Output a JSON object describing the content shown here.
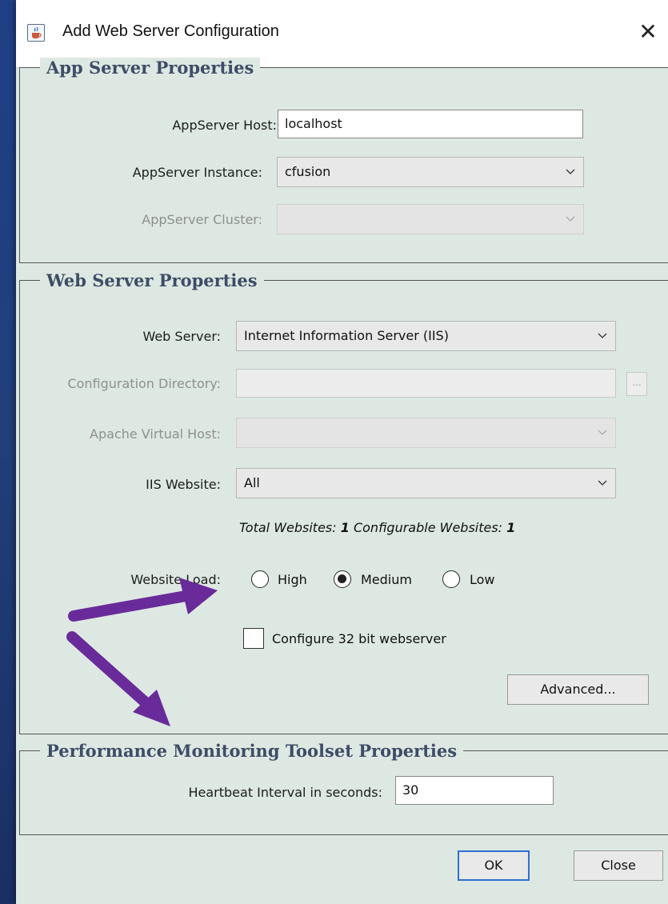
{
  "window": {
    "title": "Add Web Server Configuration",
    "close_glyph": "✕"
  },
  "app_server": {
    "section_title": "App Server Properties",
    "host_label": "AppServer Host:",
    "host_value": "localhost",
    "instance_label": "AppServer Instance:",
    "instance_value": "cfusion",
    "cluster_label": "AppServer Cluster:",
    "cluster_value": ""
  },
  "web_server": {
    "section_title": "Web Server Properties",
    "server_label": "Web Server:",
    "server_value": "Internet Information Server (IIS)",
    "config_dir_label": "Configuration Directory:",
    "config_dir_value": "",
    "browse_label": "...",
    "vhost_label": "Apache Virtual Host:",
    "vhost_value": "",
    "iis_site_label": "IIS Website:",
    "iis_site_value": "All",
    "total_label": "Total Websites:",
    "total_value": "1",
    "configurable_label": "Configurable Websites:",
    "configurable_value": "1",
    "load_label": "Website Load:",
    "load_options": [
      "High",
      "Medium",
      "Low"
    ],
    "load_selected": "Medium",
    "config32_label": "Configure 32 bit webserver",
    "config32_checked": false,
    "advanced_label": "Advanced..."
  },
  "pmt": {
    "section_title": "Performance Monitoring Toolset Properties",
    "heartbeat_label": "Heartbeat Interval in seconds:",
    "heartbeat_value": "30"
  },
  "footer": {
    "ok_label": "OK",
    "close_label": "Close"
  },
  "colors": {
    "dialog_bg": "#dde8e2",
    "section_title": "#3e4c67",
    "arrow": "#6a2b9a",
    "desktop": "#1f3f86",
    "default_button_border": "#2e6fd0"
  },
  "icons": {
    "title": "java-cup-icon",
    "close": "close-icon",
    "dropdown": "chevron-down-icon",
    "annotation": "purple-arrow-icon"
  }
}
